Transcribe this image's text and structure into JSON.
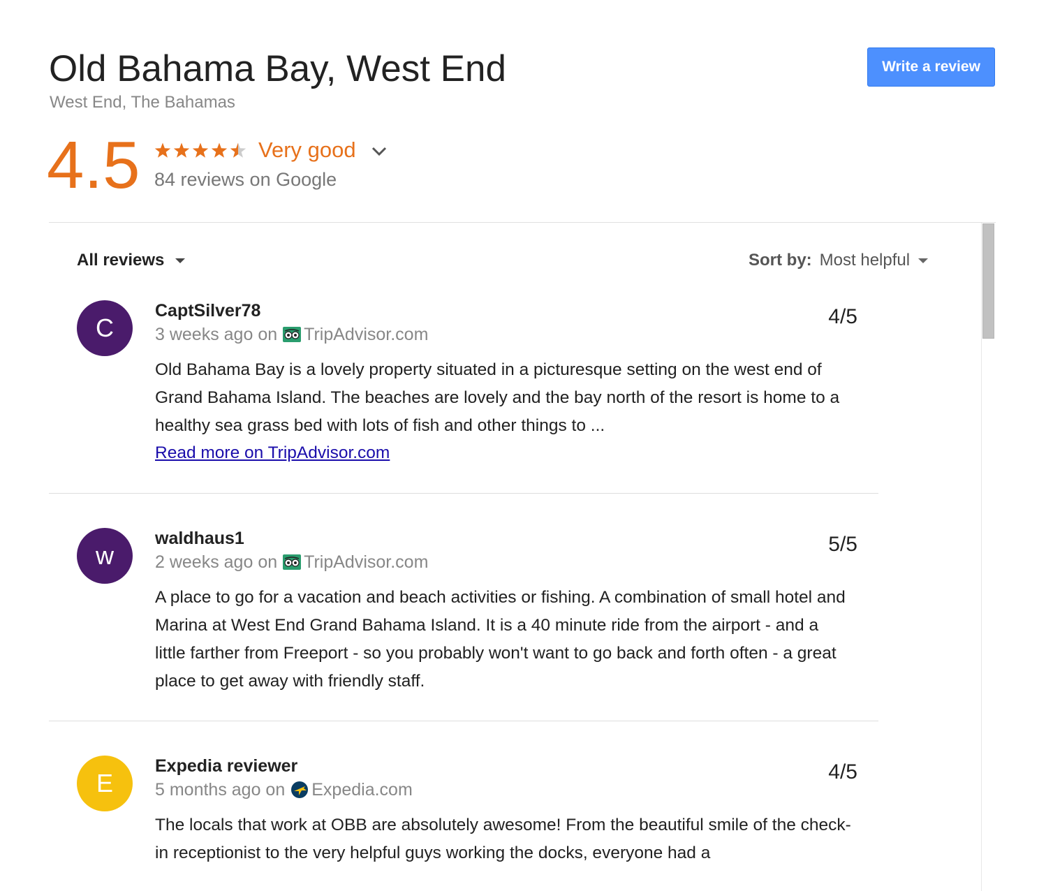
{
  "header": {
    "title": "Old Bahama Bay, West End",
    "location": "West End, The Bahamas",
    "write_review_label": "Write a review"
  },
  "rating": {
    "score": "4.5",
    "stars_value": 4.5,
    "stars_max": 5,
    "label": "Very good",
    "review_count": "84 reviews on Google",
    "accent_color": "#e7711b"
  },
  "controls": {
    "filter_label": "All reviews",
    "sort_label": "Sort by:",
    "sort_value": "Most helpful"
  },
  "reviews": [
    {
      "initial": "C",
      "avatar_color": "#4a1b6b",
      "name": "CaptSilver78",
      "time": "3 weeks ago on",
      "source": "TripAdvisor.com",
      "source_icon": "tripadvisor-icon",
      "score": "4/5",
      "text": "Old Bahama Bay is a lovely property situated in a picturesque setting on the west end of Grand Bahama Island. The beaches are lovely and the bay north of the resort is home to a healthy sea grass bed with lots of fish and other things to ...",
      "read_more": "Read more on TripAdvisor.com"
    },
    {
      "initial": "w",
      "avatar_color": "#4a1b6b",
      "name": "waldhaus1",
      "time": "2 weeks ago on",
      "source": "TripAdvisor.com",
      "source_icon": "tripadvisor-icon",
      "score": "5/5",
      "text": "A place to go for a vacation and beach activities or fishing. A combination of small hotel and Marina at West End Grand Bahama Island. It is a 40 minute ride from the airport - and a little farther from Freeport - so you probably won't want to go back and forth often - a great place to get away with friendly staff."
    },
    {
      "initial": "E",
      "avatar_color": "#f6c10e",
      "name": "Expedia reviewer",
      "time": "5 months ago on",
      "source": "Expedia.com",
      "source_icon": "expedia-icon",
      "score": "4/5",
      "text": "The locals that work at OBB are absolutely awesome! From the beautiful smile of the check-in receptionist to the very helpful guys working the docks, everyone had a"
    }
  ]
}
